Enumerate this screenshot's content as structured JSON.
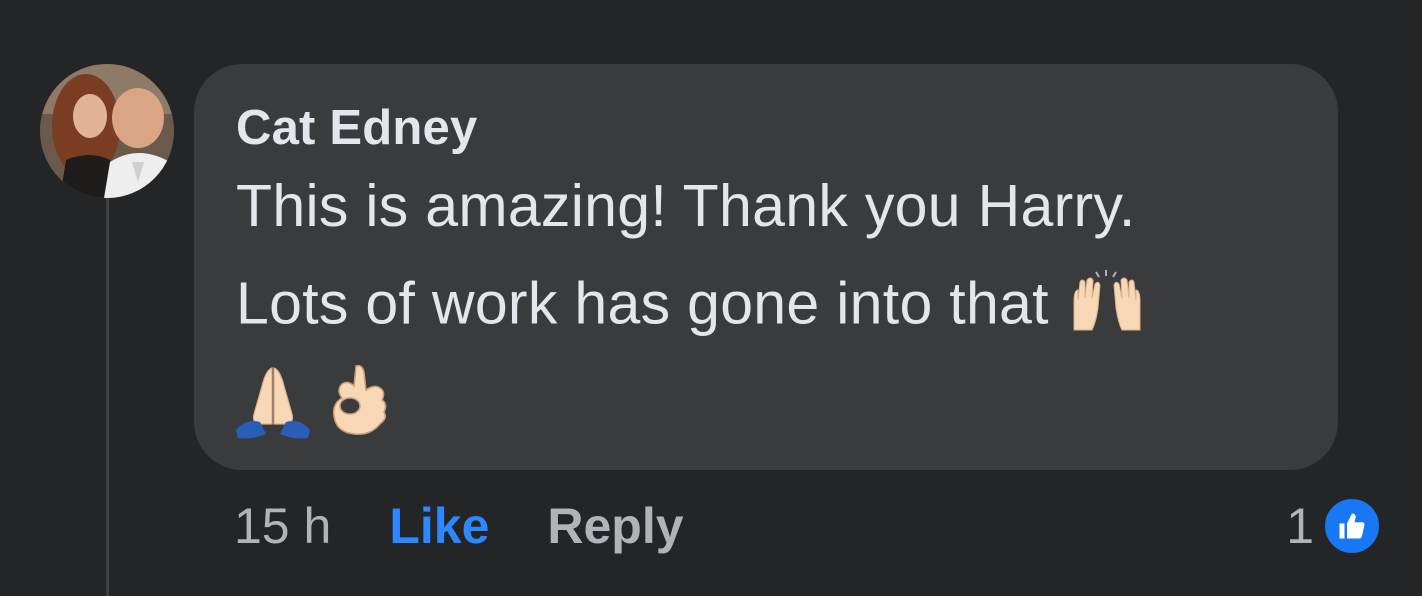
{
  "comment": {
    "author": "Cat Edney",
    "text_line1": "This is amazing! Thank you Harry.",
    "text_line2": "Lots of work has gone into that",
    "emojis": [
      "raising-hands-icon",
      "folded-hands-icon",
      "ok-hand-icon"
    ]
  },
  "actions": {
    "timestamp": "15 h",
    "like_label": "Like",
    "reply_label": "Reply"
  },
  "reactions": {
    "count": "1",
    "type": "like-reaction-icon"
  },
  "colors": {
    "background": "#242526",
    "bubble": "#3a3b3c",
    "text": "#e4e6eb",
    "secondary_text": "#b0b3b8",
    "like_blue": "#2d88ff"
  }
}
